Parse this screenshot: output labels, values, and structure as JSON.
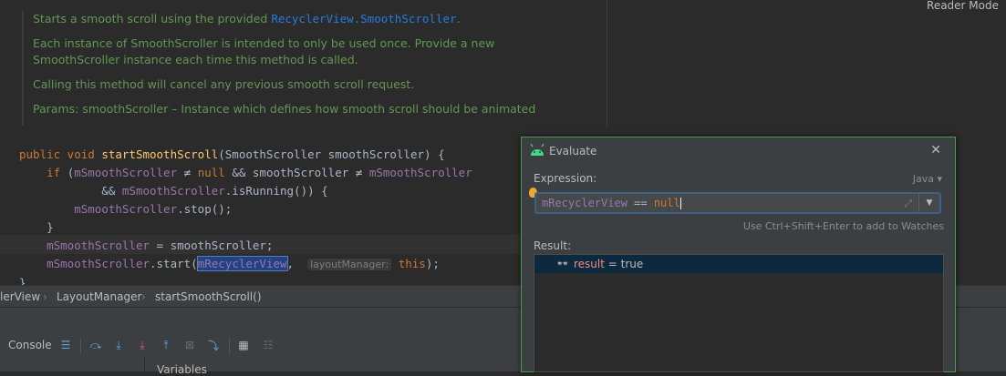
{
  "editor": {
    "reader_mode": "Reader Mode",
    "doc": {
      "line1_prefix": "Starts a smooth scroll using the provided ",
      "line1_link": "RecyclerView.SmoothScroller",
      "line1_suffix": ".",
      "line2": "Each instance of SmoothScroller is intended to only be used once. Provide a new SmoothScroller instance each time this method is called.",
      "line3": "Calling this method will cancel any previous smooth scroll request.",
      "line4": "Params: smoothScroller – Instance which defines how smooth scroll should be animated"
    },
    "code": {
      "l1_kw": "public void ",
      "l1_fn": "startSmoothScroll",
      "l1_rest": "(SmoothScroller smoothScroller) {",
      "l2_kw": "if ",
      "l2_a": "(",
      "l2_fld1": "mSmoothScroller",
      "l2_op1": " ≠ ",
      "l2_null": "null",
      "l2_b": " && smoothScroller ≠ ",
      "l2_fld2": "mSmoothScroller",
      "l3_a": "&& ",
      "l3_fld": "mSmoothScroller",
      "l3_b": ".isRunning()) {",
      "l4_fld": "mSmoothScroller",
      "l4_b": ".stop();",
      "l5": "}",
      "l6_fld": "mSmoothScroller",
      "l6_b": " = smoothScroller;",
      "l7_fld": "mSmoothScroller",
      "l7_b": ".start(",
      "l7_sel": "mRecyclerView",
      "l7_comma": ", ",
      "l7_hint": "layoutManager:",
      "l7_this": "this",
      "l7_end": ");",
      "l8": "}"
    }
  },
  "breadcrumbs": {
    "item1": "lerView",
    "item2": "LayoutManager",
    "item3": "startSmoothScroll()"
  },
  "debug_panel": {
    "console_label": "Console",
    "variables_label": "Variables",
    "toolbar_icons": [
      "list-icon",
      "step-over-icon",
      "step-into-icon",
      "force-step-into-icon",
      "step-out-icon",
      "drop-frame-icon",
      "run-to-cursor-icon",
      "evaluate-icon",
      "trace-icon"
    ]
  },
  "evaluate_dialog": {
    "title": "Evaluate",
    "expression_label": "Expression:",
    "language": "Java",
    "expression_field": "mRecyclerView",
    "expression_op": " == ",
    "expression_null": "null",
    "watch_hint": "Use Ctrl+Shift+Enter to add to Watches",
    "result_label": "Result:",
    "result_name": "result",
    "result_value": " = true"
  },
  "colors": {
    "background": "#2b2b2b",
    "panel": "#3c3f41",
    "doc_green": "#629755",
    "keyword": "#cc7832",
    "field": "#9876aa",
    "method": "#ffc66d",
    "dialog_border": "#4a9c4a",
    "result_selection": "#0d293e"
  }
}
